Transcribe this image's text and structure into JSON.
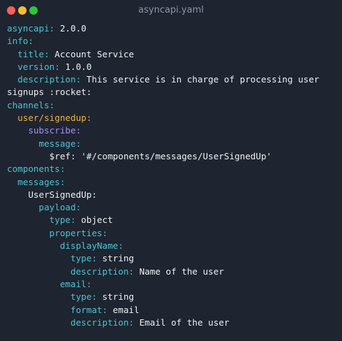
{
  "window": {
    "title": "asyncapi.yaml"
  },
  "colors": {
    "background": "#1e2430",
    "close": "#ff5f57",
    "minimize": "#febc2e",
    "maximize": "#28c840",
    "key": "#4fc3d2",
    "channel_key": "#f0b23e",
    "operation_key": "#a88ff7",
    "value": "#eef0f4"
  },
  "lines": [
    {
      "indent": "",
      "key": "asyncapi:",
      "value": " 2.0.0",
      "style": "k1"
    },
    {
      "indent": "",
      "key": "info:",
      "value": "",
      "style": "k1"
    },
    {
      "indent": "  ",
      "key": "title:",
      "value": " Account Service",
      "style": "k1"
    },
    {
      "indent": "  ",
      "key": "version:",
      "value": " 1.0.0",
      "style": "k1"
    },
    {
      "indent": "  ",
      "key": "description:",
      "value": " This service is in charge of processing user",
      "style": "k1"
    },
    {
      "indent": "",
      "key": "",
      "value": "signups :rocket:",
      "style": "k1"
    },
    {
      "indent": "",
      "key": "channels:",
      "value": "",
      "style": "k1"
    },
    {
      "indent": "  ",
      "key": "user/signedup:",
      "value": "",
      "style": "k2"
    },
    {
      "indent": "    ",
      "key": "subscribe:",
      "value": "",
      "style": "k3"
    },
    {
      "indent": "      ",
      "key": "message:",
      "value": "",
      "style": "k1"
    },
    {
      "indent": "        ",
      "key": "",
      "value": "$ref: '#/components/messages/UserSignedUp'",
      "style": "k1"
    },
    {
      "indent": "",
      "key": "components:",
      "value": "",
      "style": "k1"
    },
    {
      "indent": "  ",
      "key": "messages:",
      "value": "",
      "style": "k1"
    },
    {
      "indent": "    ",
      "key": "",
      "value": "UserSignedUp:",
      "style": "k1"
    },
    {
      "indent": "      ",
      "key": "payload:",
      "value": "",
      "style": "k1"
    },
    {
      "indent": "        ",
      "key": "type:",
      "value": " object",
      "style": "k1"
    },
    {
      "indent": "        ",
      "key": "properties:",
      "value": "",
      "style": "k1"
    },
    {
      "indent": "          ",
      "key": "displayName:",
      "value": "",
      "style": "k1"
    },
    {
      "indent": "            ",
      "key": "type:",
      "value": " string",
      "style": "k1"
    },
    {
      "indent": "            ",
      "key": "description:",
      "value": " Name of the user",
      "style": "k1"
    },
    {
      "indent": "          ",
      "key": "email:",
      "value": "",
      "style": "k1"
    },
    {
      "indent": "            ",
      "key": "type:",
      "value": " string",
      "style": "k1"
    },
    {
      "indent": "            ",
      "key": "format:",
      "value": " email",
      "style": "k1"
    },
    {
      "indent": "            ",
      "key": "description:",
      "value": " Email of the user",
      "style": "k1"
    }
  ]
}
